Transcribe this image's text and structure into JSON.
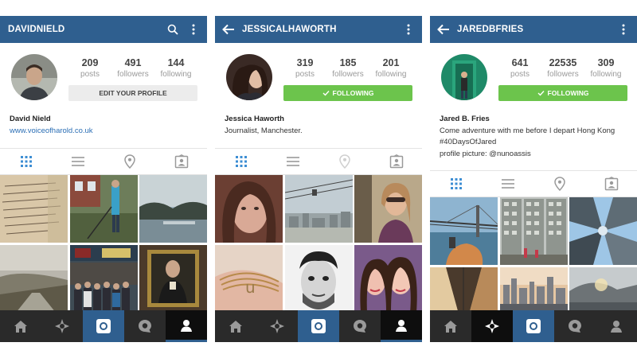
{
  "screens": [
    {
      "username": "DAVIDNIELD",
      "stats": {
        "posts": "209",
        "posts_label": "posts",
        "followers": "491",
        "followers_label": "followers",
        "following": "144",
        "following_label": "following"
      },
      "action_button": "EDIT YOUR PROFILE",
      "name": "David Nield",
      "bio_line1": "www.voiceofharold.co.uk"
    },
    {
      "username": "JESSICALHAWORTH",
      "stats": {
        "posts": "319",
        "posts_label": "posts",
        "followers": "185",
        "followers_label": "followers",
        "following": "201",
        "following_label": "following"
      },
      "action_button": "FOLLOWING",
      "name": "Jessica Haworth",
      "bio_line1": "Journalist, Manchester."
    },
    {
      "username": "JAREDBFRIES",
      "stats": {
        "posts": "641",
        "posts_label": "posts",
        "followers": "22535",
        "followers_label": "followers",
        "following": "309",
        "following_label": "following"
      },
      "action_button": "FOLLOWING",
      "name": "Jared B. Fries",
      "bio_line1": "Come adventure with me before I depart Hong Kong",
      "bio_line2": "#40DaysOfJared",
      "bio_line3": "profile picture: @nunoassis"
    }
  ],
  "colors": {
    "header": "#2f5f8f",
    "follow_green": "#6cc44c",
    "navbar": "#2a2a2a",
    "link": "#2c6fb5"
  },
  "icons": [
    "search-icon",
    "more-vert-icon",
    "back-arrow-icon",
    "grid-icon",
    "list-icon",
    "location-pin-icon",
    "tagged-photos-icon",
    "home-icon",
    "explore-icon",
    "camera-icon",
    "activity-icon",
    "profile-icon",
    "check-icon"
  ]
}
